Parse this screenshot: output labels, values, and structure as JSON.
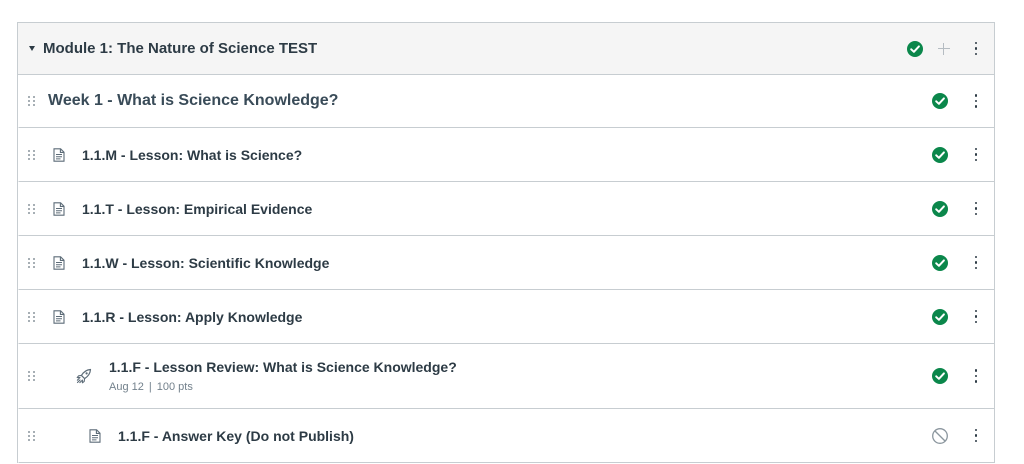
{
  "module": {
    "title": "Module 1: The Nature of Science TEST",
    "status_icon": "published-check-icon",
    "add_icon": "plus-icon",
    "menu_icon": "kebab-menu-icon"
  },
  "subheader": {
    "title": "Week 1 - What is Science Knowledge?",
    "status_icon": "published-check-icon"
  },
  "items": [
    {
      "title": "1.1.M - Lesson: What is Science?",
      "type_icon": "page-icon",
      "status": "published"
    },
    {
      "title": "1.1.T - Lesson: Empirical Evidence",
      "type_icon": "page-icon",
      "status": "published"
    },
    {
      "title": "1.1.W - Lesson: Scientific Knowledge",
      "type_icon": "page-icon",
      "status": "published"
    },
    {
      "title": "1.1.R - Lesson: Apply Knowledge",
      "type_icon": "page-icon",
      "status": "published"
    },
    {
      "title": "1.1.F - Lesson Review: What is Science Knowledge?",
      "type_icon": "quiz-rocket-icon",
      "status": "published",
      "due_date": "Aug 12",
      "separator": "|",
      "points": "100 pts"
    },
    {
      "title": "1.1.F - Answer Key (Do not Publish)",
      "type_icon": "page-icon",
      "status": "unpublished"
    }
  ],
  "colors": {
    "published": "#0b874b",
    "unpublished": "#8b969e",
    "header_bg": "#f5f5f5",
    "border": "#c7cdd1",
    "text": "#2d3b45"
  }
}
